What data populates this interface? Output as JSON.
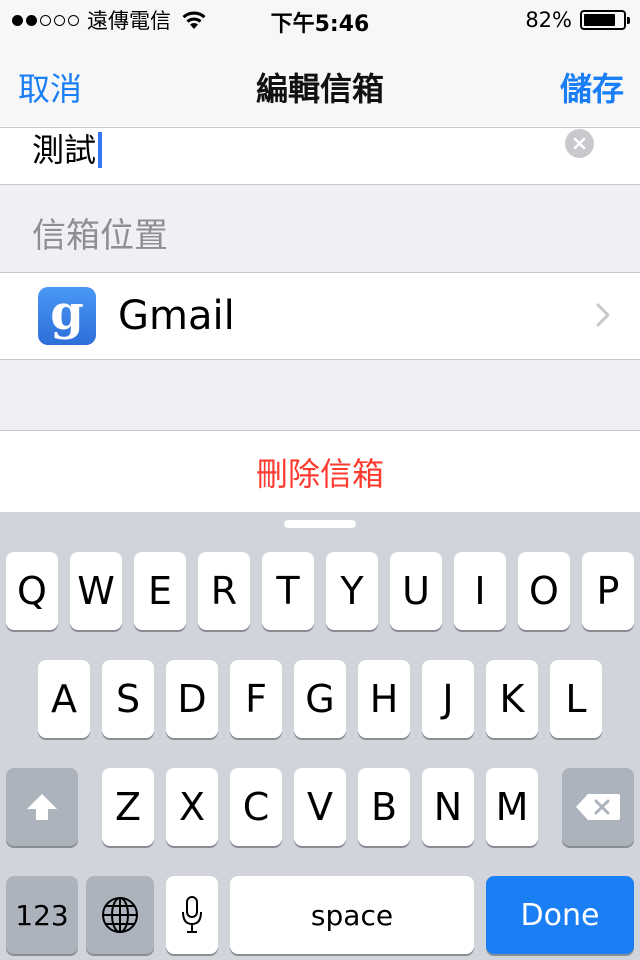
{
  "status_bar": {
    "carrier": "遠傳電信",
    "time": "下午5:46",
    "battery_percent": "82%",
    "battery_level": 0.82,
    "signal_bars_filled": 2,
    "signal_bars_total": 5
  },
  "nav": {
    "cancel_label": "取消",
    "title": "編輯信箱",
    "save_label": "儲存"
  },
  "mailbox_name": {
    "value": "測試"
  },
  "location_section": {
    "header": "信箱位置",
    "account_label": "Gmail",
    "account_icon": "google-g-icon"
  },
  "delete_label": "刪除信箱",
  "keyboard": {
    "row1": [
      "Q",
      "W",
      "E",
      "R",
      "T",
      "Y",
      "U",
      "I",
      "O",
      "P"
    ],
    "row2": [
      "A",
      "S",
      "D",
      "F",
      "G",
      "H",
      "J",
      "K",
      "L"
    ],
    "row3": [
      "Z",
      "X",
      "C",
      "V",
      "B",
      "N",
      "M"
    ],
    "numbers_label": "123",
    "space_label": "space",
    "done_label": "Done"
  },
  "colors": {
    "accent": "#1a7ef5",
    "destructive": "#ff3b30",
    "keyboard_bg": "#d1d5db"
  }
}
